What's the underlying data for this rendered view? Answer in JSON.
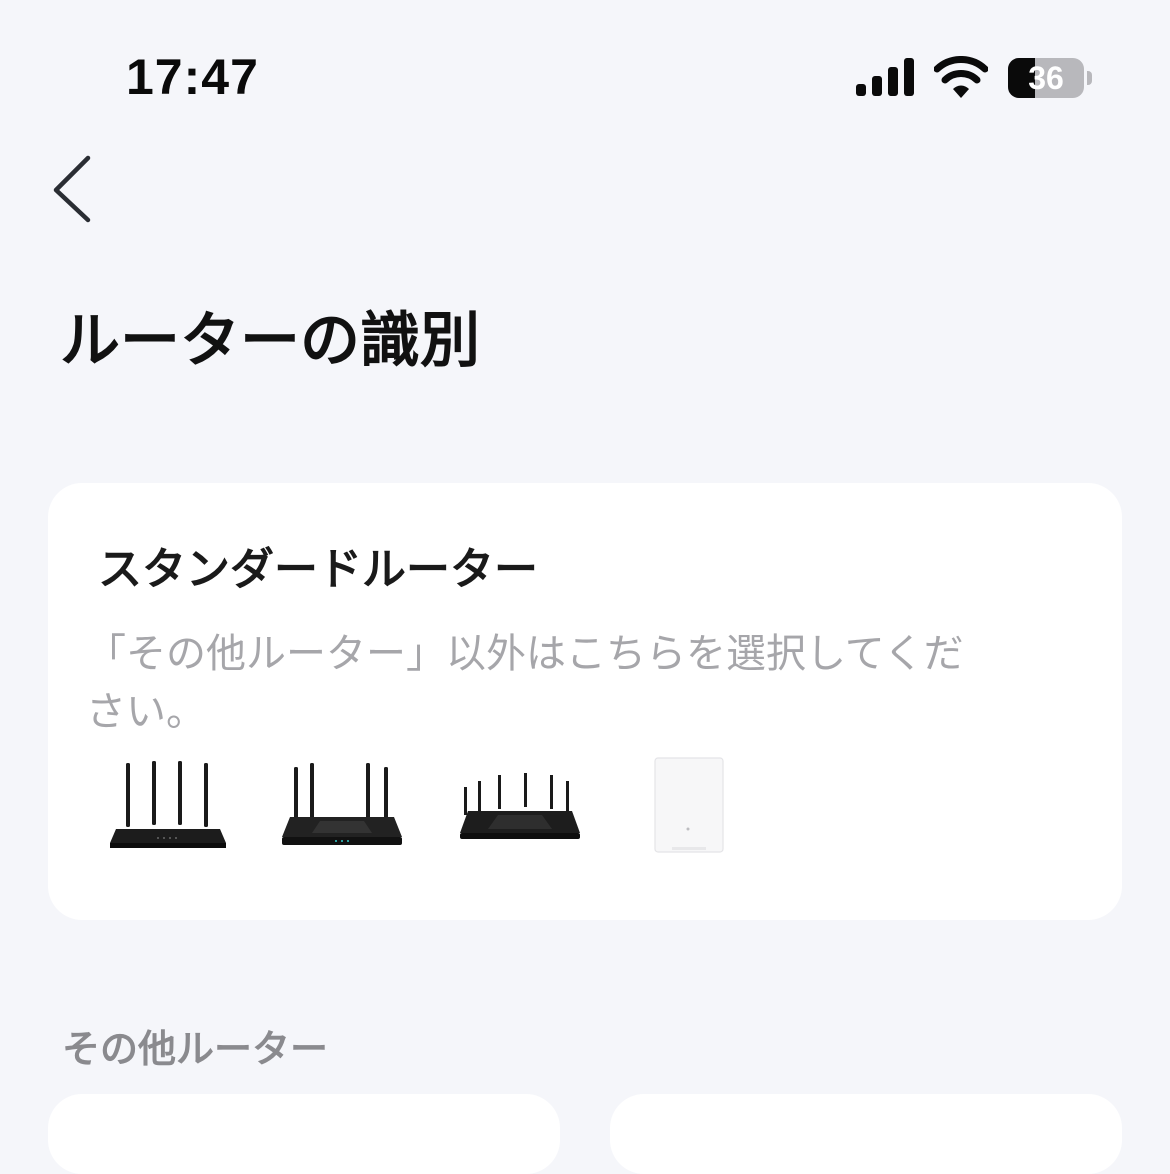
{
  "status_bar": {
    "time": "17:47",
    "battery_percent": "36",
    "battery_level": 0.36
  },
  "header": {
    "title": "ルーターの識別"
  },
  "standard_router_card": {
    "title": "スタンダードルーター",
    "description": "「その他ルーター」以外はこちらを選択してください。"
  },
  "other_routers": {
    "section_label": "その他ルーター"
  }
}
